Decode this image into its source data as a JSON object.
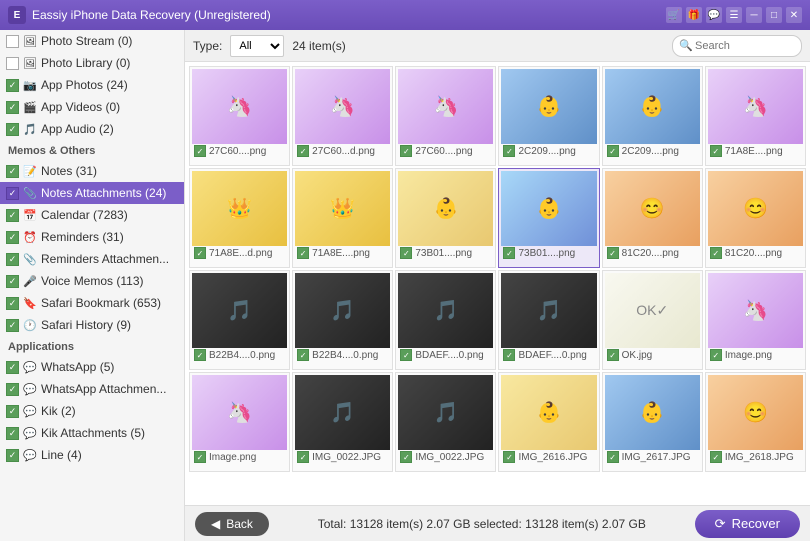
{
  "titleBar": {
    "title": "Eassiy iPhone Data Recovery (Unregistered)",
    "iconLabel": "E"
  },
  "toolbar": {
    "typeLabel": "Type:",
    "typeValue": "All",
    "itemCount": "24 item(s)",
    "searchPlaceholder": "Search"
  },
  "sidebar": {
    "sections": [
      {
        "id": "photos",
        "items": [
          {
            "id": "photo-stream",
            "label": "Photo Stream (0)",
            "checked": false,
            "icon": "🖼️"
          },
          {
            "id": "photo-library",
            "label": "Photo Library (0)",
            "checked": false,
            "icon": "🖼️"
          },
          {
            "id": "app-photos",
            "label": "App Photos (24)",
            "checked": true,
            "icon": "📷"
          },
          {
            "id": "app-videos",
            "label": "App Videos (0)",
            "checked": true,
            "icon": "🎬"
          },
          {
            "id": "app-audio",
            "label": "App Audio (2)",
            "checked": true,
            "icon": "🎵"
          }
        ]
      },
      {
        "id": "memos-others",
        "header": "Memos & Others",
        "items": [
          {
            "id": "notes",
            "label": "Notes (31)",
            "checked": true,
            "icon": "📝"
          },
          {
            "id": "notes-attachments",
            "label": "Notes Attachments (24)",
            "checked": true,
            "icon": "📎",
            "active": true
          },
          {
            "id": "calendar",
            "label": "Calendar (7283)",
            "checked": true,
            "icon": "📅"
          },
          {
            "id": "reminders",
            "label": "Reminders (31)",
            "checked": true,
            "icon": "⏰"
          },
          {
            "id": "reminders-attachments",
            "label": "Reminders Attachmen...",
            "checked": true,
            "icon": "📎"
          },
          {
            "id": "voice-memos",
            "label": "Voice Memos (113)",
            "checked": true,
            "icon": "🎤"
          },
          {
            "id": "safari-bookmark",
            "label": "Safari Bookmark (653)",
            "checked": true,
            "icon": "🔖"
          },
          {
            "id": "safari-history",
            "label": "Safari History (9)",
            "checked": true,
            "icon": "🕐"
          }
        ]
      },
      {
        "id": "applications",
        "header": "Applications",
        "items": [
          {
            "id": "whatsapp",
            "label": "WhatsApp (5)",
            "checked": true,
            "icon": "💬",
            "iconColor": "#25d366"
          },
          {
            "id": "whatsapp-attachments",
            "label": "WhatsApp Attachmen...",
            "checked": true,
            "icon": "💬",
            "iconColor": "#25d366"
          },
          {
            "id": "kik",
            "label": "Kik (2)",
            "checked": true,
            "icon": "💬",
            "iconColor": "#82bc00"
          },
          {
            "id": "kik-attachments",
            "label": "Kik Attachments (5)",
            "checked": true,
            "icon": "💬",
            "iconColor": "#82bc00"
          },
          {
            "id": "line",
            "label": "Line (4)",
            "checked": true,
            "icon": "💬",
            "iconColor": "#00c300"
          }
        ]
      }
    ]
  },
  "grid": {
    "items": [
      {
        "id": 1,
        "name": "27C60....png",
        "type": "purple-unicorn",
        "checked": true,
        "emoji": "🦄"
      },
      {
        "id": 2,
        "name": "27C60....png",
        "type": "purple-unicorn",
        "checked": true,
        "emoji": "🦄"
      },
      {
        "id": 3,
        "name": "27C60....png",
        "type": "purple-unicorn",
        "checked": true,
        "emoji": "🦄"
      },
      {
        "id": 4,
        "name": "2C209....png",
        "type": "baby-blue",
        "checked": true,
        "emoji": "👶"
      },
      {
        "id": 5,
        "name": "2C209....png",
        "type": "baby-blue",
        "checked": true,
        "emoji": "👶"
      },
      {
        "id": 6,
        "name": "71A8E....png",
        "type": "purple-unicorn",
        "checked": true,
        "emoji": "🦄"
      },
      {
        "id": 7,
        "name": "71A8E...d.png",
        "type": "purple-crown",
        "checked": true,
        "emoji": "👑"
      },
      {
        "id": 8,
        "name": "71A8E....png",
        "type": "purple-crown",
        "checked": true,
        "emoji": "👑"
      },
      {
        "id": 9,
        "name": "73B01....png",
        "type": "baby-yellow",
        "checked": true,
        "emoji": "👶"
      },
      {
        "id": 10,
        "name": "73B01....png",
        "type": "baby-selected",
        "checked": true,
        "emoji": "👶",
        "selected": true
      },
      {
        "id": 11,
        "name": "81C20....png",
        "type": "baby-smile",
        "checked": true,
        "emoji": "😊"
      },
      {
        "id": 12,
        "name": "81C20....png",
        "type": "baby-smile",
        "checked": true,
        "emoji": "😊"
      },
      {
        "id": 13,
        "name": "B22B4....0.png",
        "type": "black-item",
        "checked": true,
        "emoji": "⬛"
      },
      {
        "id": 14,
        "name": "B22B4....0.png",
        "type": "black-item",
        "checked": true,
        "emoji": "⬛"
      },
      {
        "id": 15,
        "name": "BDAEF....0.png",
        "type": "black-item",
        "checked": true,
        "emoji": "⬛"
      },
      {
        "id": 16,
        "name": "BDAEF....0.png",
        "type": "black-item",
        "checked": true,
        "emoji": "⬛"
      },
      {
        "id": 17,
        "name": "OK.jpg",
        "type": "handwritten",
        "checked": true,
        "emoji": "✍️"
      },
      {
        "id": 18,
        "name": "Image.png",
        "type": "unicorn-small",
        "checked": true,
        "emoji": "🦄"
      },
      {
        "id": 19,
        "name": "Image.png",
        "type": "unicorn-small",
        "checked": true,
        "emoji": "🦄"
      },
      {
        "id": 20,
        "name": "IMG_0022.JPG",
        "type": "black-item",
        "checked": true,
        "emoji": "⬛"
      },
      {
        "id": 21,
        "name": "IMG_0022.JPG",
        "type": "black-item",
        "checked": true,
        "emoji": "⬛"
      },
      {
        "id": 22,
        "name": "IMG_2616.JPG",
        "type": "baby-yellow2",
        "checked": true,
        "emoji": "👶"
      },
      {
        "id": 23,
        "name": "IMG_2617.JPG",
        "type": "baby-blue2",
        "checked": true,
        "emoji": "👶"
      },
      {
        "id": 24,
        "name": "IMG_2618.JPG",
        "type": "baby-smile2",
        "checked": true,
        "emoji": "😊"
      }
    ]
  },
  "statusBar": {
    "backLabel": "Back",
    "totalText": "Total: 13128 item(s) 2.07 GB   selected: 13128 item(s) 2.07 GB",
    "recoverLabel": "Recover"
  }
}
